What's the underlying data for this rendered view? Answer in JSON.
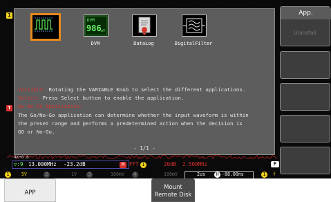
{
  "colors": {
    "accent_orange": "#e8891a",
    "ch1_yellow": "#f2d21b",
    "trigger_red": "#d8302c",
    "highlight_red": "#d83333",
    "panel_gray": "#5d5d5d"
  },
  "grid": {
    "ch1_marker": "1",
    "trigger_marker": "T"
  },
  "apps": [
    {
      "id": "gonogo",
      "icon": "go-nogo-icon",
      "label": ""
    },
    {
      "id": "dvm",
      "icon": "dvm-icon",
      "label": "DVM",
      "readout_top": "DVM",
      "readout_value": "986",
      "readout_unit": "mV"
    },
    {
      "id": "datalog",
      "icon": "datalog-icon",
      "label": "DataLog"
    },
    {
      "id": "digitalfilter",
      "icon": "digital-filter-icon",
      "label": "DigitalFilter"
    }
  ],
  "help": {
    "line1_key": "Variable:",
    "line1_text": " Rotating the VARIABLE Knob to select the different applications.",
    "line2_key": "Select:",
    "line2_text": " Press Select button to enable the application.",
    "line3_key": "Go-No-Go Application:",
    "line4": "The Go/No-Go application can determine whether the input waveform is within",
    "line5": "the preset range and performs a predetermined action when the decision is",
    "line6": "GO or No-Go."
  },
  "page_indicator": "- 1/1 -",
  "status": {
    "memory": "4K+0.8",
    "freq_prefix": "▽:9",
    "frequency": "13.000MHz",
    "gain": "-23.2dB",
    "math_badge": "M",
    "math_text": "FFT",
    "ch1_badge": "1",
    "scale": "20dB",
    "span": "2.500MHz",
    "f_badge": "F"
  },
  "channels": {
    "ch1_badge": "1",
    "ch1_scale": "5V",
    "ch2_badge": "2",
    "ch2_scale": "1V",
    "ch3_badge": "3",
    "ch3_scale": "100mV",
    "ch4_badge": "4",
    "ch4_scale": "100mV",
    "timebase": "2us",
    "position_badge": "H",
    "position": "-88.00ns",
    "trigger_ch": "1",
    "trigger_slope": "f"
  },
  "side_menu": {
    "title": "App.",
    "uninstall_label": "Uninstall"
  },
  "softkeys": {
    "app_label": "APP",
    "mount_line1": "Mount",
    "mount_line2": "Remote Disk"
  }
}
